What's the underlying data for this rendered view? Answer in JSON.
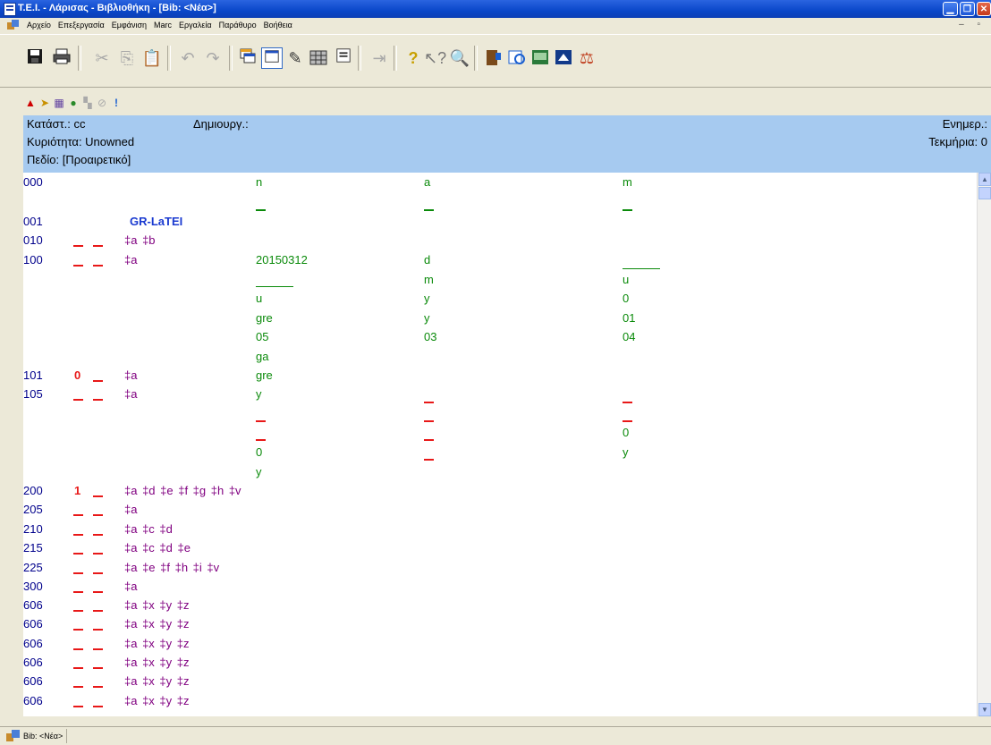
{
  "window": {
    "title": "T.E.I. - Λάρισας - Βιβλιοθήκη - [Bib: <Νέα>]"
  },
  "menu": [
    "Αρχείο",
    "Επεξεργασία",
    "Εμφάνιση",
    "Marc",
    "Εργαλεία",
    "Παράθυρο",
    "Βοήθεια"
  ],
  "header": {
    "status": "Κατάστ.: cc",
    "created": "Δημιουργ.:",
    "updated": "Ενημερ.:",
    "ownership": "Κυριότητα: Unowned",
    "items": "Τεκμήρια: 0",
    "field": "Πεδίο: [Προαιρετικό]"
  },
  "record": {
    "leader": {
      "tag": "000",
      "v1": "n",
      "v2": "a",
      "v3": "m"
    },
    "f001": {
      "tag": "001",
      "value": "GR-LaTEI"
    },
    "f010": {
      "tag": "010",
      "subs": "‡a  ‡b"
    },
    "f100": {
      "tag": "100",
      "subs": "‡a",
      "date": "20150312",
      "c2": [
        "d",
        "m",
        "y",
        "y",
        "03"
      ],
      "c1": [
        "u",
        "gre",
        "05",
        "ga"
      ],
      "c3": [
        "u",
        "0",
        "01",
        "04"
      ]
    },
    "f101": {
      "tag": "101",
      "ind1": "0",
      "subs": "‡a",
      "value": "gre"
    },
    "f105": {
      "tag": "105",
      "subs": "‡a",
      "c1a": "y",
      "c1b": "0",
      "c1c": "y",
      "c3a": "0",
      "c3b": "y"
    },
    "rows": [
      {
        "tag": "200",
        "ind1": "1",
        "subs": "‡a  ‡d  ‡e  ‡f  ‡g  ‡h  ‡v"
      },
      {
        "tag": "205",
        "subs": "‡a"
      },
      {
        "tag": "210",
        "subs": "‡a  ‡c  ‡d"
      },
      {
        "tag": "215",
        "subs": "‡a  ‡c  ‡d  ‡e"
      },
      {
        "tag": "225",
        "subs": "‡a  ‡e  ‡f  ‡h  ‡i  ‡v"
      },
      {
        "tag": "300",
        "subs": "‡a"
      },
      {
        "tag": "606",
        "subs": "‡a  ‡x  ‡y  ‡z"
      },
      {
        "tag": "606",
        "subs": "‡a  ‡x  ‡y  ‡z"
      },
      {
        "tag": "606",
        "subs": "‡a  ‡x  ‡y  ‡z"
      },
      {
        "tag": "606",
        "subs": "‡a  ‡x  ‡y  ‡z"
      },
      {
        "tag": "606",
        "subs": "‡a  ‡x  ‡y  ‡z"
      },
      {
        "tag": "606",
        "subs": "‡a  ‡x  ‡y  ‡z"
      }
    ]
  },
  "statusbar": {
    "task": "Bib: <Νέα>"
  },
  "icons": {
    "toolbar": [
      "save-icon",
      "print-icon",
      "cut-icon",
      "copy-icon",
      "paste-icon",
      "undo-icon",
      "redo-icon",
      "tile-windows-icon",
      "cascade-icon",
      "edit-form-icon",
      "grid-view-icon",
      "record-view-icon",
      "insert-field-icon",
      "help-icon",
      "context-help-icon",
      "search-icon",
      "checkout-icon",
      "catalog-icon",
      "return-books-icon",
      "patron-icon",
      "fines-icon"
    ],
    "record": [
      "warning-icon",
      "flag-icon",
      "format-icon",
      "validate-icon",
      "bookmark-icon",
      "hide-icon",
      "alert-icon"
    ]
  },
  "colors": {
    "tag": "#00008b",
    "indicator": "#e81818",
    "subfield": "#800080",
    "fixed": "#0a8a0a",
    "header": "#a6caf0",
    "title": "#0a47c9"
  }
}
